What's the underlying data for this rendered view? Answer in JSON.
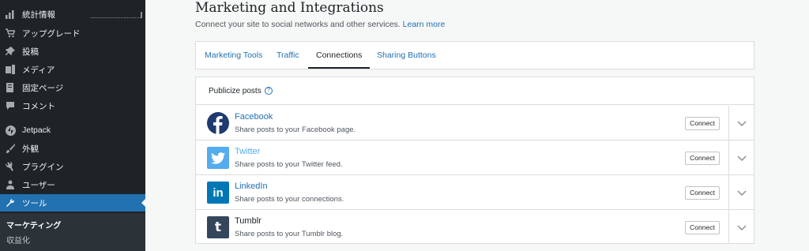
{
  "sidebar": {
    "items": [
      {
        "label": "統計情報",
        "icon": "bar-chart-icon"
      },
      {
        "label": "アップグレード",
        "icon": "cart-icon"
      },
      {
        "label": "投稿",
        "icon": "pin-icon"
      },
      {
        "label": "メディア",
        "icon": "media-icon"
      },
      {
        "label": "固定ページ",
        "icon": "page-icon"
      },
      {
        "label": "コメント",
        "icon": "comment-icon"
      },
      {
        "label": "Jetpack",
        "icon": "jetpack-icon"
      },
      {
        "label": "外観",
        "icon": "brush-icon"
      },
      {
        "label": "プラグイン",
        "icon": "plugin-icon"
      },
      {
        "label": "ユーザー",
        "icon": "user-icon"
      },
      {
        "label": "ツール",
        "icon": "wrench-icon"
      }
    ],
    "submenu": [
      {
        "label": "マーケティング"
      },
      {
        "label": "収益化"
      }
    ]
  },
  "page": {
    "title": "Marketing and Integrations",
    "description": "Connect your site to social networks and other services.",
    "learn_more": "Learn more"
  },
  "tabs": [
    {
      "label": "Marketing Tools"
    },
    {
      "label": "Traffic"
    },
    {
      "label": "Connections"
    },
    {
      "label": "Sharing Buttons"
    }
  ],
  "publicize": {
    "header": "Publicize posts",
    "help_icon": "?",
    "services": [
      {
        "name": "Facebook",
        "desc": "Share posts to your Facebook page.",
        "button": "Connect",
        "color": "#1e3a6e",
        "glyph": "f"
      },
      {
        "name": "Twitter",
        "desc": "Share posts to your Twitter feed.",
        "button": "Connect",
        "color": "#55acee",
        "glyph": "🐦"
      },
      {
        "name": "LinkedIn",
        "desc": "Share posts to your connections.",
        "button": "Connect",
        "color": "#0077b5",
        "glyph": "in"
      },
      {
        "name": "Tumblr",
        "desc": "Share posts to your Tumblr blog.",
        "button": "Connect",
        "color": "#35465c",
        "glyph": "t"
      }
    ]
  }
}
